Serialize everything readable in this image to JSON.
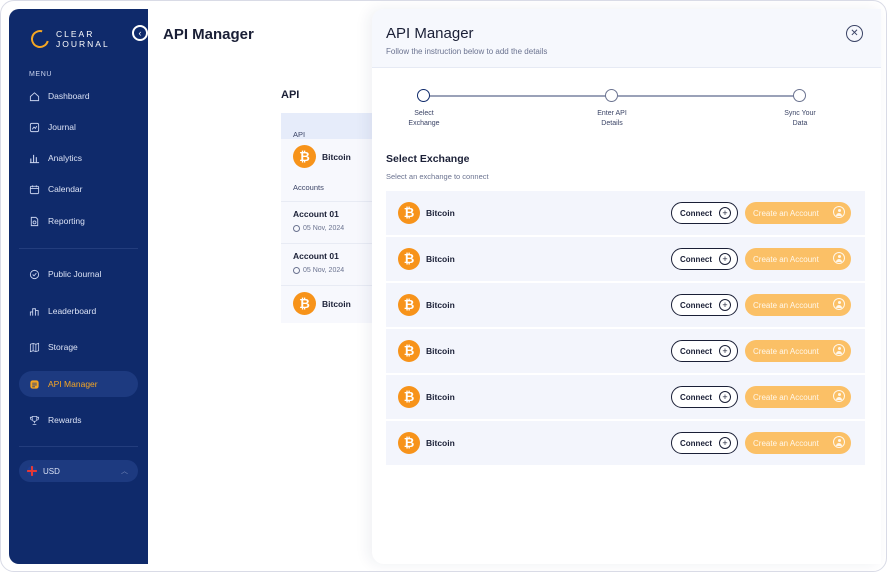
{
  "sidebar": {
    "logo_line1": "CLEAR",
    "logo_line2": "JOURNAL",
    "menu_label": "MENU",
    "items": [
      {
        "label": "Dashboard",
        "icon": "home-icon"
      },
      {
        "label": "Journal",
        "icon": "journal-icon"
      },
      {
        "label": "Analytics",
        "icon": "analytics-icon"
      },
      {
        "label": "Calendar",
        "icon": "calendar-icon"
      },
      {
        "label": "Reporting",
        "icon": "reporting-icon"
      },
      {
        "label": "Public Journal",
        "icon": "public-journal-icon"
      },
      {
        "label": "Leaderboard",
        "icon": "leaderboard-icon"
      },
      {
        "label": "Storage",
        "icon": "storage-icon"
      },
      {
        "label": "API Manager",
        "icon": "api-icon"
      },
      {
        "label": "Rewards",
        "icon": "trophy-icon"
      }
    ],
    "active_item": "API Manager",
    "currency": "USD",
    "accent_color": "#f5a623",
    "background_color": "#0f2a6b"
  },
  "background_page": {
    "title": "API Manager",
    "api_label": "API",
    "api_section": "API",
    "api_exchange": "Bitcoin",
    "accounts_label": "Accounts",
    "accounts": [
      {
        "name": "Account 01",
        "date": "05 Nov, 2024"
      },
      {
        "name": "Account 01",
        "date": "05 Nov, 2024"
      }
    ],
    "bottom_exchange": "Bitcoin"
  },
  "drawer": {
    "title": "API Manager",
    "subtitle": "Follow the instruction below to add the details",
    "steps": [
      {
        "line1": "Select",
        "line2": "Exchange",
        "active": true
      },
      {
        "line1": "Enter API",
        "line2": "Details",
        "active": false
      },
      {
        "line1": "Sync Your",
        "line2": "Data",
        "active": false
      }
    ],
    "section_title": "Select Exchange",
    "section_subtitle": "Select an exchange to connect",
    "connect_label": "Connect",
    "create_label": "Create an Account",
    "exchanges": [
      "Bitcoin",
      "Bitcoin",
      "Bitcoin",
      "Bitcoin",
      "Bitcoin",
      "Bitcoin"
    ],
    "create_button_color": "#fbc066"
  }
}
